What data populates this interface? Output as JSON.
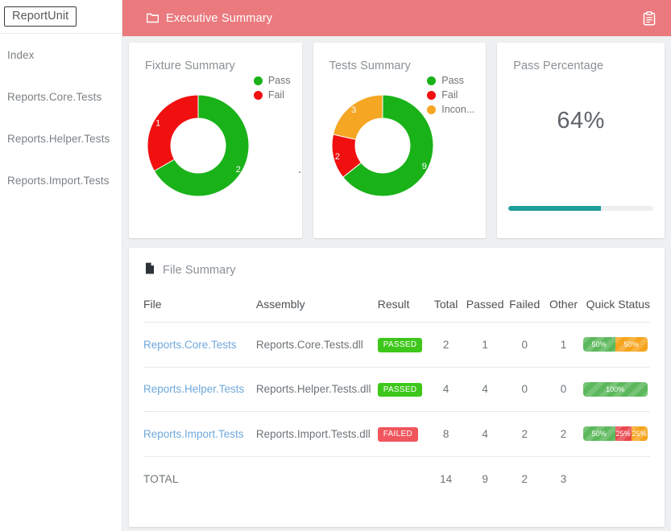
{
  "brand": {
    "label": "ReportUnit"
  },
  "sidebar": {
    "items": [
      {
        "label": "Index"
      },
      {
        "label": "Reports.Core.Tests"
      },
      {
        "label": "Reports.Helper.Tests"
      },
      {
        "label": "Reports.Import.Tests"
      }
    ]
  },
  "topbar": {
    "title": "Executive Summary",
    "folder_icon": "folder-icon",
    "action_icon": "clipboard-icon",
    "background_color": "#ea7a7e"
  },
  "colors": {
    "pass": "#19b219",
    "fail": "#f01010",
    "inconclusive": "#f5a623",
    "progress_teal": "#1d9e9b",
    "link": "#6fa8dc"
  },
  "chart_data": [
    {
      "type": "pie",
      "title": "Fixture Summary",
      "legend": [
        "Pass",
        "Fail"
      ],
      "legend_position": "top-right",
      "categories": [
        "Pass",
        "Fail"
      ],
      "values": [
        2,
        1
      ],
      "labels": [
        "2",
        "1"
      ],
      "colors": [
        "#19b219",
        "#f01010"
      ],
      "total": 3,
      "donut": true
    },
    {
      "type": "pie",
      "title": "Tests Summary",
      "legend": [
        "Pass",
        "Fail",
        "Incon..."
      ],
      "legend_position": "top-right",
      "categories": [
        "Pass",
        "Fail",
        "Inconclusive"
      ],
      "values": [
        9,
        2,
        3
      ],
      "labels": [
        "9",
        "2",
        "3"
      ],
      "colors": [
        "#19b219",
        "#f01010",
        "#f5a623"
      ],
      "total": 14,
      "donut": true
    },
    {
      "type": "bar",
      "title": "Pass Percentage",
      "value_label": "64%",
      "values": [
        64
      ],
      "categories": [
        "Pass Percentage"
      ],
      "ylim": [
        0,
        100
      ],
      "bar_color": "#1d9e9b",
      "track_color": "#eceff0"
    }
  ],
  "file_summary": {
    "title": "File Summary",
    "icon": "file-icon",
    "columns": [
      "File",
      "Assembly",
      "Result",
      "Total",
      "Passed",
      "Failed",
      "Other",
      "Quick Status"
    ],
    "rows": [
      {
        "file": "Reports.Core.Tests",
        "assembly": "Reports.Core.Tests.dll",
        "result": "PASSED",
        "result_state": "passed",
        "total": "2",
        "passed": "1",
        "failed": "0",
        "other": "1",
        "quick_status": [
          {
            "label": "50%",
            "color": "green",
            "pct": 50
          },
          {
            "label": "50%",
            "color": "orange",
            "pct": 50
          }
        ]
      },
      {
        "file": "Reports.Helper.Tests",
        "assembly": "Reports.Helper.Tests.dll",
        "result": "PASSED",
        "result_state": "passed",
        "total": "4",
        "passed": "4",
        "failed": "0",
        "other": "0",
        "quick_status": [
          {
            "label": "100%",
            "color": "green",
            "pct": 100
          }
        ]
      },
      {
        "file": "Reports.Import.Tests",
        "assembly": "Reports.Import.Tests.dll",
        "result": "FAILED",
        "result_state": "failed",
        "total": "8",
        "passed": "4",
        "failed": "2",
        "other": "2",
        "quick_status": [
          {
            "label": "50%",
            "color": "green",
            "pct": 50
          },
          {
            "label": "25%",
            "color": "red",
            "pct": 25
          },
          {
            "label": "25%",
            "color": "orange",
            "pct": 25
          }
        ]
      }
    ],
    "total_row": {
      "label": "TOTAL",
      "total": "14",
      "passed": "9",
      "failed": "2",
      "other": "3"
    }
  }
}
